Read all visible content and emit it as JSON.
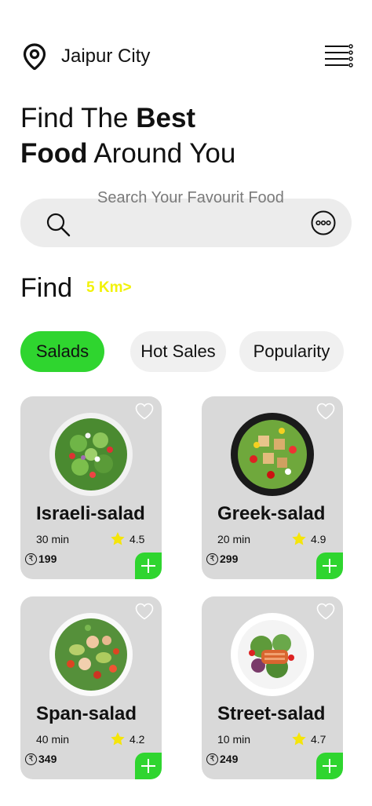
{
  "header": {
    "city": "Jaipur City"
  },
  "headline": {
    "part1": "Find The ",
    "bold1": "Best",
    "bold2": "Food",
    "part2": " Around You"
  },
  "search": {
    "placeholder": "Search Your Favourit Food"
  },
  "find": {
    "title": "Find",
    "distance": "5 Km>"
  },
  "chips": [
    {
      "label": "Salads",
      "active": true
    },
    {
      "label": "Hot Sales",
      "active": false
    },
    {
      "label": "Popularity",
      "active": false
    }
  ],
  "items": [
    {
      "name": "Israeli-salad",
      "time": "30 min",
      "rating": "4.5",
      "price": "199"
    },
    {
      "name": "Greek-salad",
      "time": "20 min",
      "rating": "4.9",
      "price": "299"
    },
    {
      "name": "Span-salad",
      "time": "40 min",
      "rating": "4.2",
      "price": "349"
    },
    {
      "name": "Street-salad",
      "time": "10 min",
      "rating": "4.7",
      "price": "249"
    }
  ],
  "colors": {
    "accent": "#2fd52f",
    "highlight": "#f2f20a",
    "card": "#d9d9d9",
    "search_bg": "#ececec"
  },
  "icons": [
    "location-pin-icon",
    "menu-icon",
    "search-icon",
    "more-icon",
    "heart-icon",
    "star-icon",
    "rupee-icon",
    "plus-icon"
  ]
}
